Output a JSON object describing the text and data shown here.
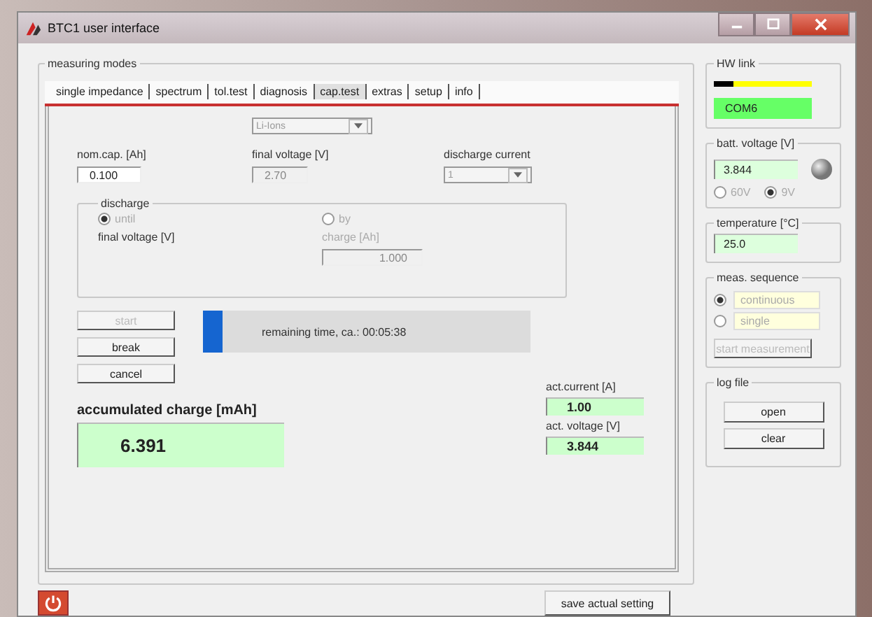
{
  "window": {
    "title": "BTC1 user interface"
  },
  "measuring_modes": {
    "title": "measuring modes",
    "tabs": [
      {
        "label": "single impedance",
        "selected": false
      },
      {
        "label": "spectrum",
        "selected": false
      },
      {
        "label": "tol.test",
        "selected": false
      },
      {
        "label": "diagnosis",
        "selected": false
      },
      {
        "label": "cap.test",
        "selected": true
      },
      {
        "label": "extras",
        "selected": false
      },
      {
        "label": "setup",
        "selected": false
      },
      {
        "label": "info",
        "selected": false
      }
    ],
    "battery_type": {
      "value": "Li-Ions",
      "disabled": true
    },
    "nom_cap": {
      "label": "nom.cap. [Ah]",
      "value": "0.100",
      "disabled": false
    },
    "final_voltage": {
      "label": "final voltage [V]",
      "value": "2.70",
      "disabled": true
    },
    "discharge_current": {
      "label": "discharge current",
      "value": "1",
      "disabled": true
    },
    "discharge": {
      "title": "discharge",
      "options": [
        {
          "label": "until",
          "selected": true,
          "disabled": true
        },
        {
          "label": "by",
          "selected": false,
          "disabled": true
        }
      ],
      "until_label": "final voltage [V]",
      "by_label": "charge [Ah]",
      "charge": {
        "value": "1.000",
        "disabled": true
      }
    },
    "buttons": [
      {
        "label": "start",
        "disabled": true
      },
      {
        "label": "break",
        "disabled": false
      },
      {
        "label": "cancel",
        "disabled": false
      }
    ],
    "progress": {
      "level": 0.06,
      "text": "remaining time, ca.:  00:05:38"
    },
    "act_current": {
      "label": "act.current [A]",
      "value": "1.00"
    },
    "act_voltage": {
      "label": "act. voltage [V]",
      "value": "3.844"
    },
    "accumulated_charge": {
      "label": "accumulated charge [mAh]",
      "value": "6.391"
    }
  },
  "hw_link": {
    "title": "HW link",
    "level": 0.2,
    "port": "COM6"
  },
  "batt_voltage": {
    "title": "batt. voltage [V]",
    "value": "3.844",
    "options": [
      {
        "label": "60V",
        "selected": false,
        "disabled": true
      },
      {
        "label": "9V",
        "selected": true,
        "disabled": true
      }
    ]
  },
  "temperature": {
    "title": "temperature [°C]",
    "value": "25.0"
  },
  "meas_sequence": {
    "title": "meas. sequence",
    "options": [
      {
        "label": "continuous",
        "selected": true,
        "disabled": true
      },
      {
        "label": "single",
        "selected": false,
        "disabled": true
      }
    ],
    "button": {
      "label": "start measurement",
      "disabled": true
    }
  },
  "log_file": {
    "title": "log file",
    "buttons": [
      "open",
      "clear"
    ]
  },
  "footer": {
    "save_button": "save actual setting"
  }
}
